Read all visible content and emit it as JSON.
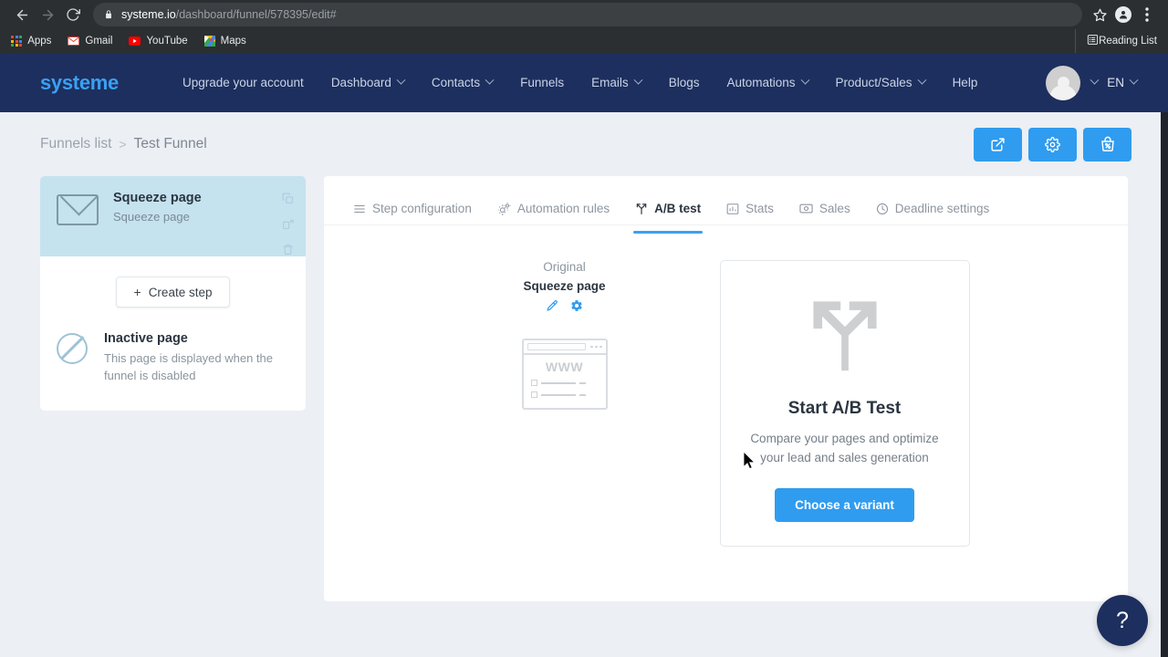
{
  "browser": {
    "url_domain": "systeme.io",
    "url_path": "/dashboard/funnel/578395/edit#",
    "back_icon": "back-arrow-icon",
    "forward_icon": "forward-arrow-icon",
    "reload_icon": "reload-icon",
    "lock_icon": "lock-icon",
    "star_icon": "star-icon",
    "profile_icon": "profile-icon",
    "menu_icon": "kebab-menu-icon",
    "bookmarks": [
      {
        "label": "Apps",
        "icon": "apps-grid-icon"
      },
      {
        "label": "Gmail",
        "icon": "gmail-icon"
      },
      {
        "label": "YouTube",
        "icon": "youtube-icon"
      },
      {
        "label": "Maps",
        "icon": "maps-icon"
      }
    ],
    "reading_list": {
      "label": "Reading List",
      "icon": "reading-list-icon"
    }
  },
  "topnav": {
    "brand": "systeme",
    "items": [
      {
        "label": "Upgrade your account",
        "caret": false
      },
      {
        "label": "Dashboard",
        "caret": true
      },
      {
        "label": "Contacts",
        "caret": true
      },
      {
        "label": "Funnels",
        "caret": false
      },
      {
        "label": "Emails",
        "caret": true
      },
      {
        "label": "Blogs",
        "caret": false
      },
      {
        "label": "Automations",
        "caret": true
      },
      {
        "label": "Product/Sales",
        "caret": true
      },
      {
        "label": "Help",
        "caret": false
      }
    ],
    "language": "EN"
  },
  "breadcrumb": {
    "root": "Funnels list",
    "separator": ">",
    "current": "Test Funnel",
    "actions": [
      {
        "name": "preview-button",
        "icon": "external-link-icon"
      },
      {
        "name": "settings-button",
        "icon": "gear-icon"
      },
      {
        "name": "sales-bag-button",
        "icon": "shopping-bag-percent-icon"
      }
    ]
  },
  "sidebar": {
    "step": {
      "icon": "envelope-icon",
      "title": "Squeeze page",
      "subtitle": "Squeeze page",
      "actions": [
        {
          "name": "duplicate-step-icon",
          "icon": "copy-icon"
        },
        {
          "name": "clone-step-icon",
          "icon": "clone-icon"
        },
        {
          "name": "delete-step-icon",
          "icon": "trash-icon"
        }
      ]
    },
    "create_step": {
      "label": "Create step",
      "plus": "+"
    },
    "inactive": {
      "icon": "ban-icon",
      "title": "Inactive page",
      "description": "This page is displayed when the funnel is disabled"
    }
  },
  "main": {
    "tabs": [
      {
        "label": "Step configuration",
        "icon": "list-lines-icon",
        "active": false
      },
      {
        "label": "Automation rules",
        "icon": "gears-icon",
        "active": false
      },
      {
        "label": "A/B test",
        "icon": "split-path-icon",
        "active": true
      },
      {
        "label": "Stats",
        "icon": "bar-chart-icon",
        "active": false
      },
      {
        "label": "Sales",
        "icon": "money-icon",
        "active": false
      },
      {
        "label": "Deadline settings",
        "icon": "clock-icon",
        "active": false
      }
    ],
    "variant": {
      "label": "Original",
      "name": "Squeeze page",
      "icons": [
        {
          "name": "edit-page-icon",
          "icon": "magic-wand-icon"
        },
        {
          "name": "page-settings-icon",
          "icon": "gear-icon"
        }
      ],
      "thumbnail_text": "WWW"
    },
    "ab_card": {
      "icon": "fork-arrows-icon",
      "title": "Start A/B Test",
      "description": "Compare your pages and optimize your lead and sales generation",
      "button_label": "Choose a variant"
    }
  },
  "help": {
    "label": "?"
  },
  "colors": {
    "brand_blue": "#3ba0f4",
    "accent_blue": "#2f9cf0",
    "nav_navy": "#1d2f5e",
    "page_bg": "#eceff4",
    "sidebar_active": "#c5e2ef"
  }
}
